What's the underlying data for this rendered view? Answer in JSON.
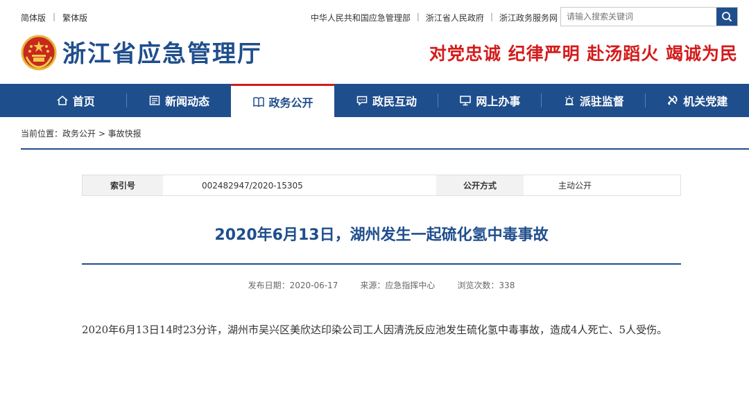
{
  "topbar": {
    "lang_simplified": "简体版",
    "lang_traditional": "繁体版",
    "links": [
      "中华人民共和国应急管理部",
      "浙江省人民政府",
      "浙江政务服务网"
    ],
    "search_placeholder": "请输入搜索关键词",
    "search_icon": "search-icon"
  },
  "header": {
    "site_title": "浙江省应急管理厅",
    "slogan": "对党忠诚 纪律严明 赴汤蹈火 竭诚为民",
    "emblem_icon": "national-emblem-icon"
  },
  "nav": {
    "items": [
      {
        "label": "首页",
        "icon": "home-icon"
      },
      {
        "label": "新闻动态",
        "icon": "newspaper-icon"
      },
      {
        "label": "政务公开",
        "icon": "book-icon"
      },
      {
        "label": "政民互动",
        "icon": "chat-icon"
      },
      {
        "label": "网上办事",
        "icon": "monitor-icon"
      },
      {
        "label": "派驻监督",
        "icon": "alarm-icon"
      },
      {
        "label": "机关党建",
        "icon": "party-icon"
      }
    ],
    "active_index": 2
  },
  "breadcrumb": {
    "text": "当前位置：政务公开 > 事故快报"
  },
  "info": {
    "index_label": "索引号",
    "index_value": "002482947/2020-15305",
    "method_label": "公开方式",
    "method_value": "主动公开"
  },
  "article": {
    "title": "2020年6月13日，湖州发生一起硫化氢中毒事故",
    "publish_date": "发布日期：2020-06-17",
    "source": "来源：应急指挥中心",
    "views": "浏览次数：338",
    "body": "2020年6月13日14时23分许，湖州市吴兴区美欣达印染公司工人因清洗反应池发生硫化氢中毒事故，造成4人死亡、5人受伤。"
  },
  "colors": {
    "brand_blue": "#1f4e8c",
    "slogan_red": "#d41b1b"
  }
}
